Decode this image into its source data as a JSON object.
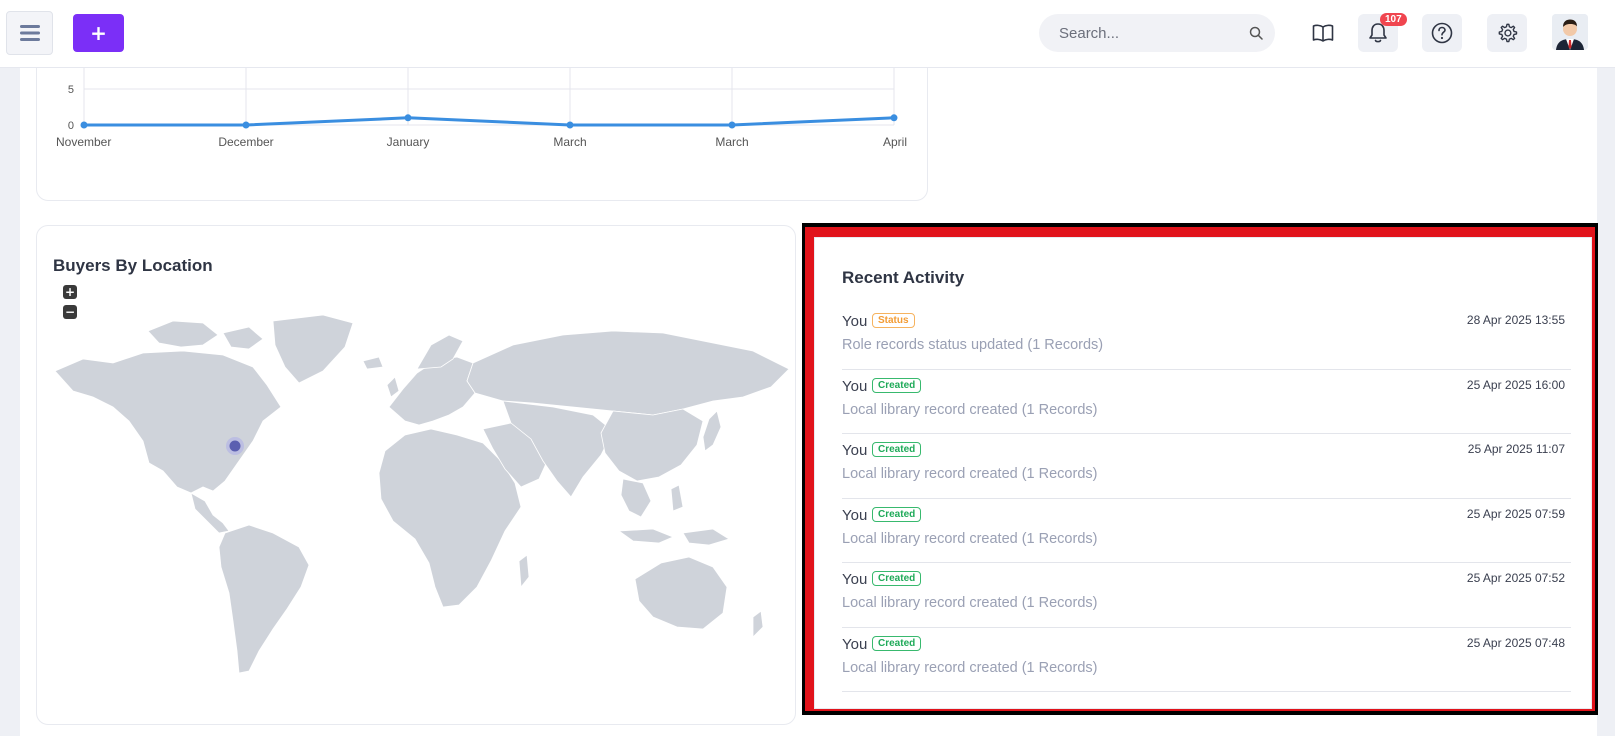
{
  "topbar": {
    "search_placeholder": "Search...",
    "notification_count": "107"
  },
  "chart_data": {
    "type": "line",
    "categories": [
      "November",
      "December",
      "January",
      "March",
      "March",
      "April"
    ],
    "series": [
      {
        "values": [
          0,
          0,
          1,
          0,
          0,
          1
        ]
      }
    ],
    "y_ticks": [
      "5",
      "0"
    ],
    "ylim": [
      0,
      10
    ],
    "grid": true,
    "color": "#3a8ee0"
  },
  "map_card": {
    "title": "Buyers By Location",
    "zoom_in_label": "+",
    "zoom_out_label": "−"
  },
  "activity": {
    "title": "Recent Activity",
    "items": [
      {
        "who": "You",
        "tag": "Status",
        "tag_type": "status",
        "desc": "Role records status updated (1 Records)",
        "time": "28 Apr 2025 13:55"
      },
      {
        "who": "You",
        "tag": "Created",
        "tag_type": "created",
        "desc": "Local library record created (1 Records)",
        "time": "25 Apr 2025 16:00"
      },
      {
        "who": "You",
        "tag": "Created",
        "tag_type": "created",
        "desc": "Local library record created (1 Records)",
        "time": "25 Apr 2025 11:07"
      },
      {
        "who": "You",
        "tag": "Created",
        "tag_type": "created",
        "desc": "Local library record created (1 Records)",
        "time": "25 Apr 2025 07:59"
      },
      {
        "who": "You",
        "tag": "Created",
        "tag_type": "created",
        "desc": "Local library record created (1 Records)",
        "time": "25 Apr 2025 07:52"
      },
      {
        "who": "You",
        "tag": "Created",
        "tag_type": "created",
        "desc": "Local library record created (1 Records)",
        "time": "25 Apr 2025 07:48"
      }
    ]
  },
  "colors": {
    "accent": "#7b2ff7",
    "badge": "#f0454f",
    "highlight_border": "#e1131b",
    "map_land": "#cfd3da",
    "map_marker": "#5b5fb0"
  }
}
